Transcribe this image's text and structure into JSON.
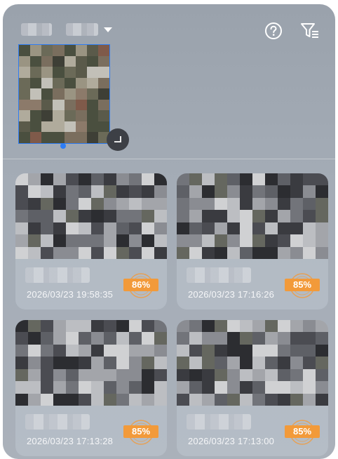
{
  "header": {
    "title_blurred": "",
    "help_icon": "help-circle-icon",
    "filter_icon": "filter-list-icon"
  },
  "query": {
    "selection_color": "#2e7df5",
    "resize_icon": "crop-corner-icon"
  },
  "results": [
    {
      "time": "2026/03/23 19:58:35",
      "score": "86%"
    },
    {
      "time": "2026/03/23 17:16:26",
      "score": "85%"
    },
    {
      "time": "2026/03/23 17:13:28",
      "score": "85%"
    },
    {
      "time": "2026/03/23 17:13:00",
      "score": "85%"
    }
  ],
  "colors": {
    "accent": "#2e7df5",
    "score_badge": "#f29a3a",
    "panel_bg": "#a2aab4"
  }
}
